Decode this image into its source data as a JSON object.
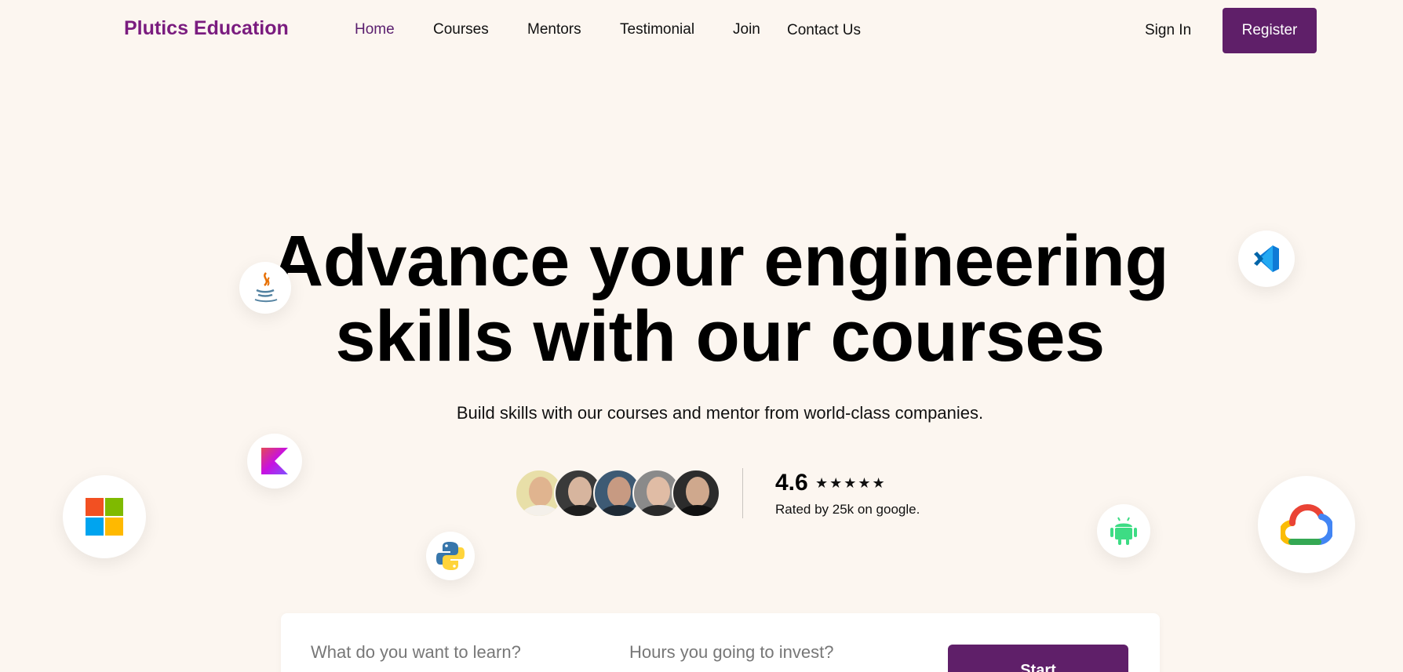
{
  "brand": {
    "name": "Plutics Education",
    "color": "#7a1c7f"
  },
  "nav": {
    "links": [
      {
        "label": "Home",
        "active": true
      },
      {
        "label": "Courses",
        "active": false
      },
      {
        "label": "Mentors",
        "active": false
      },
      {
        "label": "Testimonial",
        "active": false
      },
      {
        "label": "Join",
        "active": false
      },
      {
        "label": "Contact Us",
        "active": false
      }
    ],
    "sign_in": "Sign In",
    "register": "Register"
  },
  "hero": {
    "title_line1": "Advance your engineering",
    "title_line2": "skills with our courses",
    "subtitle": "Build skills with our courses and mentor from world-class companies."
  },
  "rating": {
    "value": "4.6",
    "stars": "★★★★★",
    "note": "Rated by 25k on google.",
    "avatar_count": 5
  },
  "floating_icons": [
    "java-icon",
    "vscode-icon",
    "kotlin-icon",
    "microsoft-icon",
    "python-icon",
    "android-icon",
    "google-cloud-icon"
  ],
  "search": {
    "learn_placeholder": "What do you want to learn?",
    "hours_placeholder": "Hours you going to invest?",
    "start_label": "Start"
  },
  "colors": {
    "accent": "#5f1f69",
    "background": "#fcf6f0"
  }
}
